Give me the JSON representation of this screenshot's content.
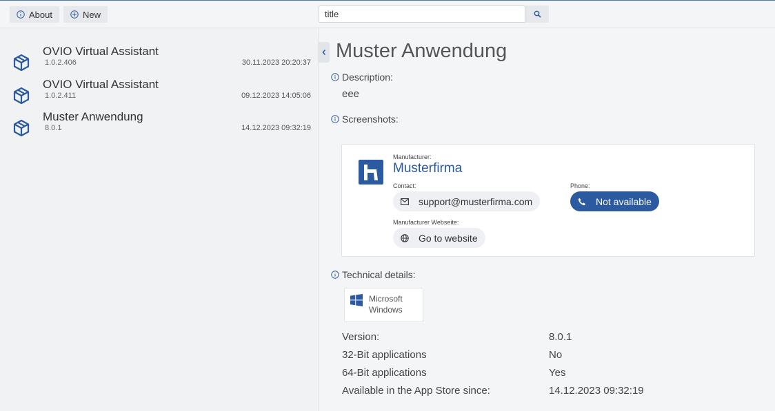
{
  "toolbar": {
    "about_label": "About",
    "new_label": "New",
    "search_value": "title"
  },
  "apps": [
    {
      "name": "OVIO Virtual Assistant",
      "version": "1.0.2.406",
      "date": "30.11.2023 20:20:37"
    },
    {
      "name": "OVIO Virtual Assistant",
      "version": "1.0.2.411",
      "date": "09.12.2023 14:05:06"
    },
    {
      "name": "Muster Anwendung",
      "version": "8.0.1",
      "date": "14.12.2023 09:32:19"
    }
  ],
  "detail": {
    "title": "Muster Anwendung",
    "description_label": "Description:",
    "description": "eee",
    "screenshots_label": "Screenshots:",
    "manufacturer_label": "Manufacturer:",
    "manufacturer": "Musterfirma",
    "contact_label": "Contact:",
    "contact_email": "support@musterfirma.com",
    "phone_label": "Phone:",
    "phone_value": "Not available",
    "website_label": "Manufacturer Webseite:",
    "website_button": "Go to website",
    "technical_label": "Technical details:",
    "platform_line1": "Microsoft",
    "platform_line2": "Windows",
    "details": [
      {
        "key": "Version:",
        "value": "8.0.1"
      },
      {
        "key": "32-Bit applications",
        "value": "No"
      },
      {
        "key": "64-Bit applications",
        "value": "Yes"
      },
      {
        "key": "Available in the App Store since:",
        "value": "14.12.2023 09:32:19"
      }
    ]
  },
  "colors": {
    "accent": "#2b5aa0",
    "background": "#f4f5f7"
  }
}
